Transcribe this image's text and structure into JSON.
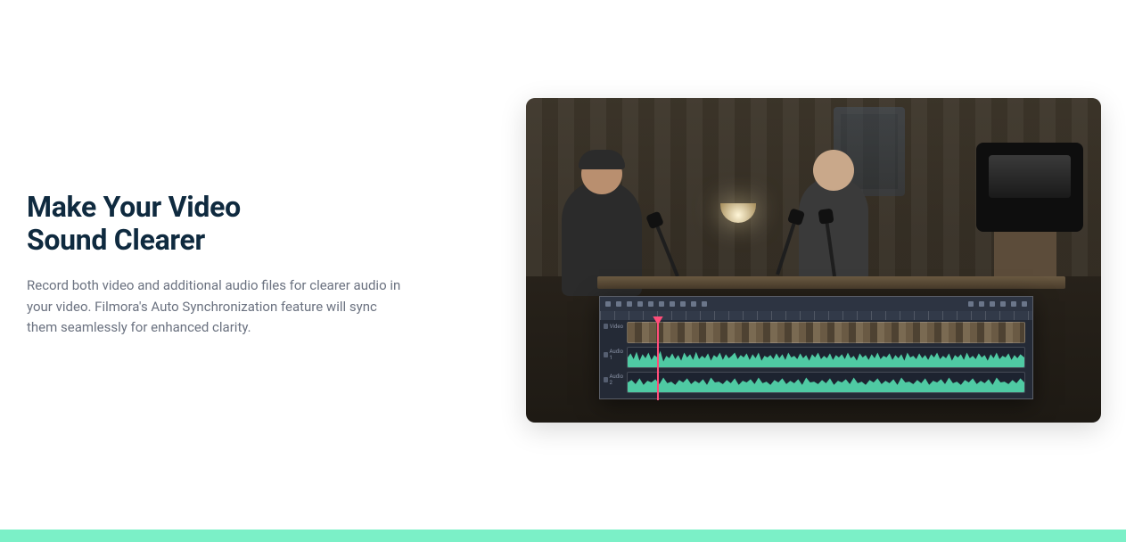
{
  "heading": {
    "line1": "Make Your Video",
    "line2": "Sound Clearer"
  },
  "description": "Record both video and additional audio files for clearer audio in your video. Filmora's Auto Synchronization feature will sync them seamlessly for enhanced clarity.",
  "timeline": {
    "tracks": [
      {
        "label": "Video"
      },
      {
        "label": "Audio 1"
      },
      {
        "label": "Audio 2"
      }
    ]
  },
  "colors": {
    "accent": "#7bf0c7",
    "headingColor": "#0f2a3f",
    "waveform": "#4fcaa3",
    "playhead": "#ff4d79"
  }
}
